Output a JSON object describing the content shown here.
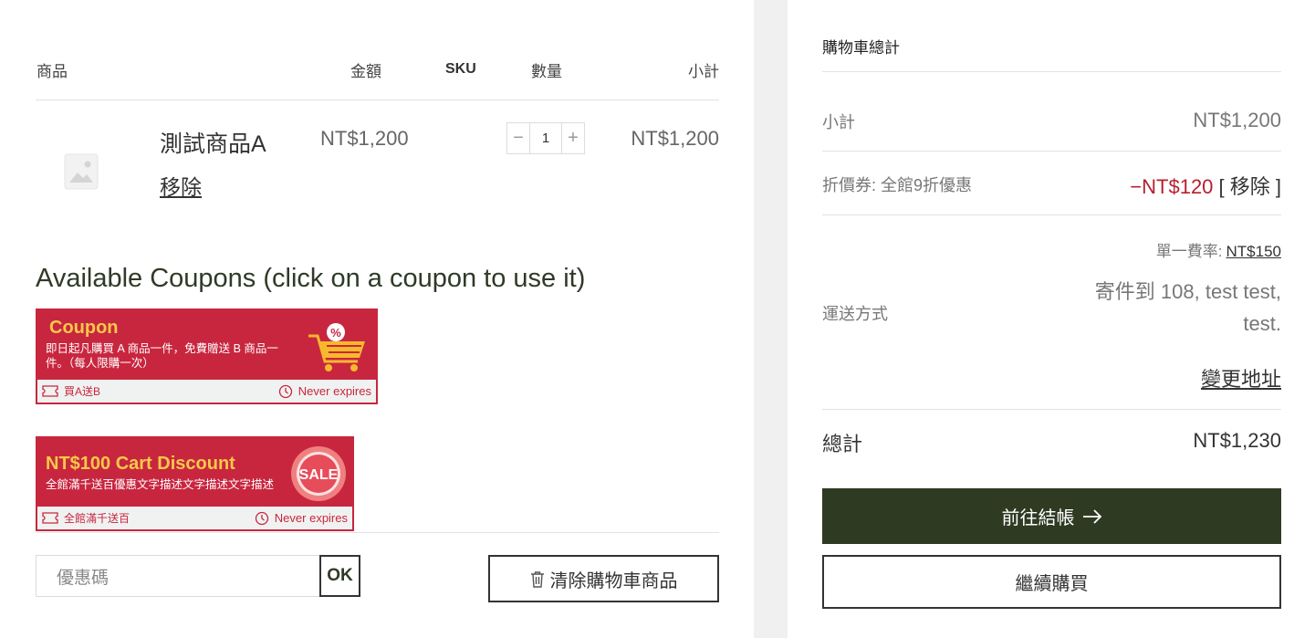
{
  "cart_table": {
    "headers": {
      "product": "商品",
      "price": "金額",
      "sku": "SKU",
      "quantity": "數量",
      "subtotal": "小計"
    },
    "items": [
      {
        "name": "測試商品A",
        "remove_label": "移除",
        "price": "NT$1,200",
        "quantity": "1",
        "subtotal": "NT$1,200"
      }
    ]
  },
  "coupons": {
    "title": "Available Coupons (click on a coupon to use it)",
    "list": [
      {
        "title": "Coupon",
        "description": "即日起凡購買 A 商品一件，免費贈送 B 商品一件。（每人限購一次）",
        "code": "買A送B",
        "expiry": "Never expires",
        "badge": "%"
      },
      {
        "title": "NT$100 Cart Discount",
        "description": "全館滿千送百優惠文字描述文字描述文字描述",
        "code": "全館滿千送百",
        "expiry": "Never expires",
        "badge": "SALE"
      }
    ]
  },
  "coupon_form": {
    "placeholder": "優惠碼",
    "ok_label": "OK"
  },
  "clear_cart_label": "清除購物車商品",
  "totals": {
    "title": "購物車總計",
    "subtotal_label": "小計",
    "subtotal_value": "NT$1,200",
    "coupon_label": "折價券: 全館9折優惠",
    "coupon_value": "−NT$120",
    "coupon_remove": "[ 移除 ]",
    "shipping_label": "運送方式",
    "shipping_rate_label": "單一費率:",
    "shipping_rate_value": "NT$150",
    "shipping_address": "寄件到 108, test test, test.",
    "change_address": "變更地址",
    "total_label": "總計",
    "total_value": "NT$1,230",
    "checkout_label": "前往結帳",
    "continue_label": "繼續購買"
  },
  "colors": {
    "coupon_red": "#c8263f",
    "coupon_yellow": "#f7c948",
    "checkout_bg": "#2f3a23",
    "discount_red": "#b61f2d"
  }
}
